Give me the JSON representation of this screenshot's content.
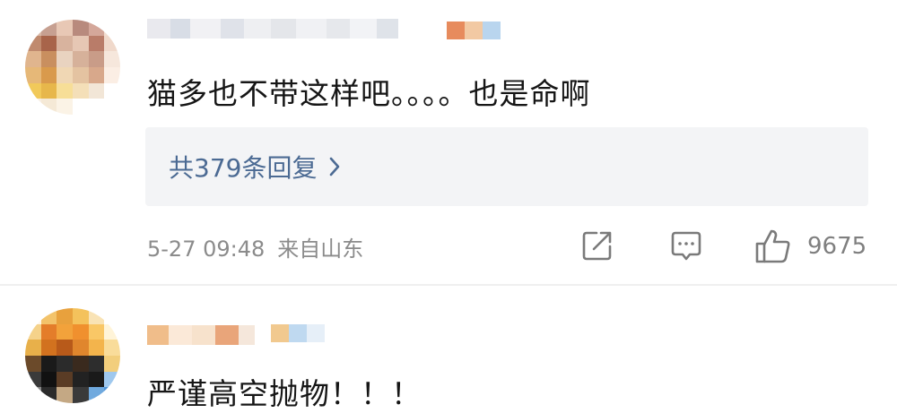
{
  "comments": [
    {
      "text": "猫多也不带这样吧。。。。也是命啊",
      "replies_label": "共379条回复",
      "time": "5-27 09:48",
      "location": "来自山东",
      "likes": "9675",
      "icons": [
        "share-icon",
        "comment-icon",
        "like-icon",
        "chevron-right-icon"
      ]
    },
    {
      "text": "严谨高空抛物！！！"
    }
  ],
  "colors": {
    "reply_link": "#4b6a93",
    "meta_text": "#8b8b8b",
    "reply_bg": "#f3f4f6"
  }
}
